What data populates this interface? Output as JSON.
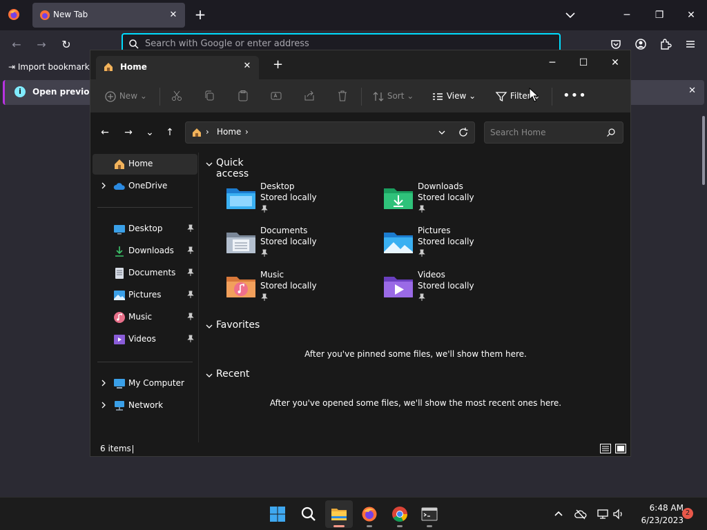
{
  "browser": {
    "tab": {
      "title": "New Tab"
    },
    "urlbar": {
      "placeholder": "Search with Google or enter address"
    },
    "bookmarks": {
      "import_label": "Import bookmarks"
    },
    "infobar": {
      "text": "Open previous ta"
    }
  },
  "explorer": {
    "tab": {
      "title": "Home"
    },
    "toolbar": {
      "new_label": "New",
      "sort_label": "Sort",
      "view_label": "View",
      "filter_label": "Filter"
    },
    "address": {
      "crumb": "Home",
      "search_placeholder": "Search Home"
    },
    "nav": {
      "home": "Home",
      "onedrive": "OneDrive",
      "pinned": [
        "Desktop",
        "Downloads",
        "Documents",
        "Pictures",
        "Music",
        "Videos"
      ],
      "my_computer": "My Computer",
      "network": "Network"
    },
    "sections": {
      "quick_access": "Quick access",
      "favorites": "Favorites",
      "recent": "Recent"
    },
    "quick_access": [
      {
        "name": "Desktop",
        "sub": "Stored locally",
        "icon": "desktop-folder-icon"
      },
      {
        "name": "Downloads",
        "sub": "Stored locally",
        "icon": "downloads-folder-icon"
      },
      {
        "name": "Documents",
        "sub": "Stored locally",
        "icon": "documents-folder-icon"
      },
      {
        "name": "Pictures",
        "sub": "Stored locally",
        "icon": "pictures-folder-icon"
      },
      {
        "name": "Music",
        "sub": "Stored locally",
        "icon": "music-folder-icon"
      },
      {
        "name": "Videos",
        "sub": "Stored locally",
        "icon": "videos-folder-icon"
      }
    ],
    "favorites_empty": "After you've pinned some files, we'll show them here.",
    "recent_empty": "After you've opened some files, we'll show the most recent ones here.",
    "status": {
      "items": "6 items"
    }
  },
  "taskbar": {
    "time": "6:48 AM",
    "date": "6/23/2023",
    "notifications": "2"
  },
  "colors": {
    "accent_cyan": "#00ddff",
    "infobar_accent": "#b833e1",
    "explorer_bg": "#191919"
  }
}
